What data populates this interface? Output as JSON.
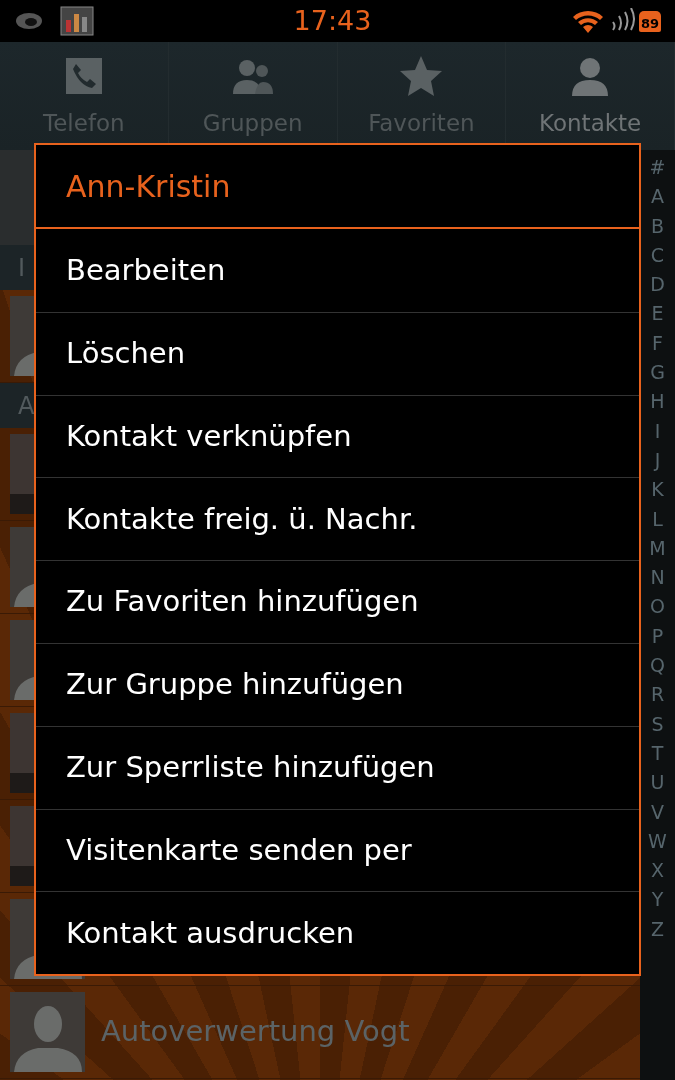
{
  "status_bar": {
    "time": "17:43",
    "battery": "89"
  },
  "tabs": [
    {
      "label": "Telefon",
      "selected": false
    },
    {
      "label": "Gruppen",
      "selected": false
    },
    {
      "label": "Favoriten",
      "selected": false
    },
    {
      "label": "Kontakte",
      "selected": true
    }
  ],
  "contacts": [
    {
      "kind": "header",
      "label": "I"
    },
    {
      "kind": "avatar"
    },
    {
      "kind": "header",
      "label": "A"
    },
    {
      "kind": "picture"
    },
    {
      "kind": "avatar"
    },
    {
      "kind": "avatar"
    },
    {
      "kind": "picture"
    },
    {
      "kind": "picture"
    },
    {
      "kind": "avatar"
    },
    {
      "kind": "avatar",
      "name": "Autoverwertung Vogt"
    }
  ],
  "index": [
    "#",
    "A",
    "B",
    "C",
    "D",
    "E",
    "F",
    "G",
    "H",
    "I",
    "J",
    "K",
    "L",
    "M",
    "N",
    "O",
    "P",
    "Q",
    "R",
    "S",
    "T",
    "U",
    "V",
    "W",
    "X",
    "Y",
    "Z"
  ],
  "dialog": {
    "title": "Ann-Kristin",
    "items": [
      "Bearbeiten",
      "Löschen",
      "Kontakt verknüpfen",
      "Kontakte freig. ü. Nachr.",
      "Zu Favoriten hinzufügen",
      "Zur Gruppe hinzufügen",
      "Zur Sperrliste hinzufügen",
      "Visitenkarte senden per",
      "Kontakt ausdrucken"
    ]
  }
}
